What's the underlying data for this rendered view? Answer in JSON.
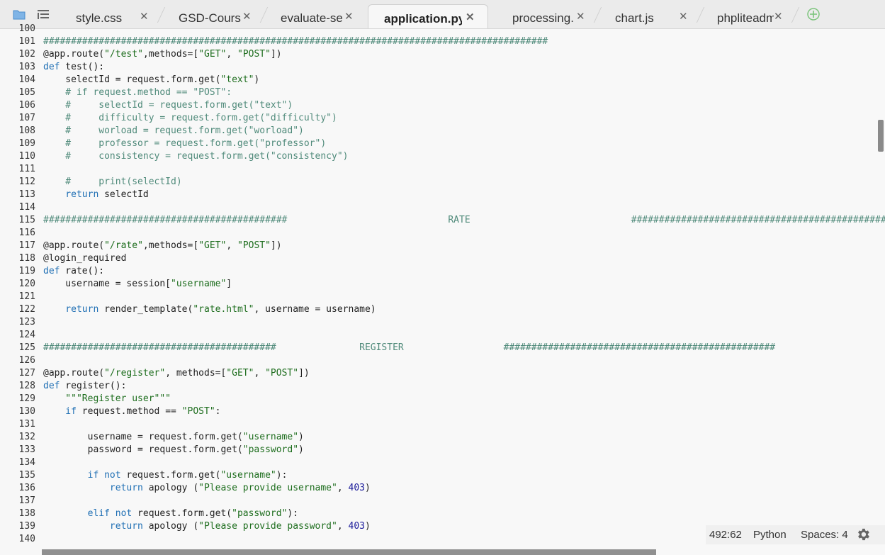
{
  "tabs": [
    {
      "label": "style.css",
      "active": false
    },
    {
      "label": "GSD-Cours",
      "active": false
    },
    {
      "label": "evaluate-se",
      "active": false
    },
    {
      "label": "application.py",
      "active": true
    },
    {
      "label": "processing.",
      "active": false
    },
    {
      "label": "chart.js",
      "active": false
    },
    {
      "label": "phpliteadmi",
      "active": false
    }
  ],
  "close_glyph": "✕",
  "status": {
    "cursor": "492:62",
    "language": "Python",
    "indent": "Spaces: 4"
  },
  "lines": [
    {
      "n": "100",
      "t": []
    },
    {
      "n": "101",
      "t": [
        [
          "c",
          "###########################################################################################"
        ]
      ]
    },
    {
      "n": "102",
      "t": [
        [
          "d",
          "@app.route"
        ],
        [
          "p",
          "("
        ],
        [
          "s",
          "\"/test\""
        ],
        [
          "p",
          ",methods=["
        ],
        [
          "s",
          "\"GET\""
        ],
        [
          "p",
          ", "
        ],
        [
          "s",
          "\"POST\""
        ],
        [
          "p",
          "])"
        ]
      ]
    },
    {
      "n": "103",
      "t": [
        [
          "k",
          "def"
        ],
        [
          "p",
          " test():"
        ]
      ]
    },
    {
      "n": "104",
      "t": [
        [
          "p",
          "    selectId = request.form.get("
        ],
        [
          "s",
          "\"text\""
        ],
        [
          "p",
          ")"
        ]
      ]
    },
    {
      "n": "105",
      "t": [
        [
          "c",
          "    # if request.method == \"POST\":"
        ]
      ]
    },
    {
      "n": "106",
      "t": [
        [
          "c",
          "    #     selectId = request.form.get(\"text\")"
        ]
      ]
    },
    {
      "n": "107",
      "t": [
        [
          "c",
          "    #     difficulty = request.form.get(\"difficulty\")"
        ]
      ]
    },
    {
      "n": "108",
      "t": [
        [
          "c",
          "    #     worload = request.form.get(\"worload\")"
        ]
      ]
    },
    {
      "n": "109",
      "t": [
        [
          "c",
          "    #     professor = request.form.get(\"professor\")"
        ]
      ]
    },
    {
      "n": "110",
      "t": [
        [
          "c",
          "    #     consistency = request.form.get(\"consistency\")"
        ]
      ]
    },
    {
      "n": "111",
      "t": []
    },
    {
      "n": "112",
      "t": [
        [
          "c",
          "    #     print(selectId)"
        ]
      ]
    },
    {
      "n": "113",
      "t": [
        [
          "k",
          "    return"
        ],
        [
          "p",
          " selectId"
        ]
      ]
    },
    {
      "n": "114",
      "t": []
    },
    {
      "n": "115",
      "t": [
        [
          "c",
          "############################################                             RATE                             ##############################################"
        ]
      ]
    },
    {
      "n": "116",
      "t": []
    },
    {
      "n": "117",
      "t": [
        [
          "d",
          "@app.route"
        ],
        [
          "p",
          "("
        ],
        [
          "s",
          "\"/rate\""
        ],
        [
          "p",
          ",methods=["
        ],
        [
          "s",
          "\"GET\""
        ],
        [
          "p",
          ", "
        ],
        [
          "s",
          "\"POST\""
        ],
        [
          "p",
          "])"
        ]
      ]
    },
    {
      "n": "118",
      "t": [
        [
          "d",
          "@login_required"
        ]
      ]
    },
    {
      "n": "119",
      "t": [
        [
          "k",
          "def"
        ],
        [
          "p",
          " rate():"
        ]
      ]
    },
    {
      "n": "120",
      "t": [
        [
          "p",
          "    username = session["
        ],
        [
          "s",
          "\"username\""
        ],
        [
          "p",
          "]"
        ]
      ]
    },
    {
      "n": "121",
      "t": []
    },
    {
      "n": "122",
      "t": [
        [
          "k",
          "    return"
        ],
        [
          "p",
          " render_template("
        ],
        [
          "s",
          "\"rate.html\""
        ],
        [
          "p",
          ", username = username)"
        ]
      ]
    },
    {
      "n": "123",
      "t": []
    },
    {
      "n": "124",
      "t": []
    },
    {
      "n": "125",
      "t": [
        [
          "c",
          "##########################################               REGISTER                  #################################################"
        ]
      ]
    },
    {
      "n": "126",
      "t": []
    },
    {
      "n": "127",
      "t": [
        [
          "d",
          "@app.route"
        ],
        [
          "p",
          "("
        ],
        [
          "s",
          "\"/register\""
        ],
        [
          "p",
          ", methods=["
        ],
        [
          "s",
          "\"GET\""
        ],
        [
          "p",
          ", "
        ],
        [
          "s",
          "\"POST\""
        ],
        [
          "p",
          "])"
        ]
      ]
    },
    {
      "n": "128",
      "t": [
        [
          "k",
          "def"
        ],
        [
          "p",
          " register():"
        ]
      ]
    },
    {
      "n": "129",
      "t": [
        [
          "s",
          "    \"\"\"Register user\"\"\""
        ]
      ]
    },
    {
      "n": "130",
      "t": [
        [
          "k",
          "    if"
        ],
        [
          "p",
          " request.method == "
        ],
        [
          "s",
          "\"POST\""
        ],
        [
          "p",
          ":"
        ]
      ]
    },
    {
      "n": "131",
      "t": []
    },
    {
      "n": "132",
      "t": [
        [
          "p",
          "        username = request.form.get("
        ],
        [
          "s",
          "\"username\""
        ],
        [
          "p",
          ")"
        ]
      ]
    },
    {
      "n": "133",
      "t": [
        [
          "p",
          "        password = request.form.get("
        ],
        [
          "s",
          "\"password\""
        ],
        [
          "p",
          ")"
        ]
      ]
    },
    {
      "n": "134",
      "t": []
    },
    {
      "n": "135",
      "t": [
        [
          "k",
          "        if not"
        ],
        [
          "p",
          " request.form.get("
        ],
        [
          "s",
          "\"username\""
        ],
        [
          "p",
          "):"
        ]
      ]
    },
    {
      "n": "136",
      "t": [
        [
          "k",
          "            return"
        ],
        [
          "p",
          " apology ("
        ],
        [
          "s",
          "\"Please provide username\""
        ],
        [
          "p",
          ", "
        ],
        [
          "n",
          "403"
        ],
        [
          "p",
          ")"
        ]
      ]
    },
    {
      "n": "137",
      "t": []
    },
    {
      "n": "138",
      "t": [
        [
          "k",
          "        elif not"
        ],
        [
          "p",
          " request.form.get("
        ],
        [
          "s",
          "\"password\""
        ],
        [
          "p",
          "):"
        ]
      ]
    },
    {
      "n": "139",
      "t": [
        [
          "k",
          "            return"
        ],
        [
          "p",
          " apology ("
        ],
        [
          "s",
          "\"Please provide password\""
        ],
        [
          "p",
          ", "
        ],
        [
          "n",
          "403"
        ],
        [
          "p",
          ")"
        ]
      ]
    },
    {
      "n": "140",
      "t": []
    }
  ]
}
